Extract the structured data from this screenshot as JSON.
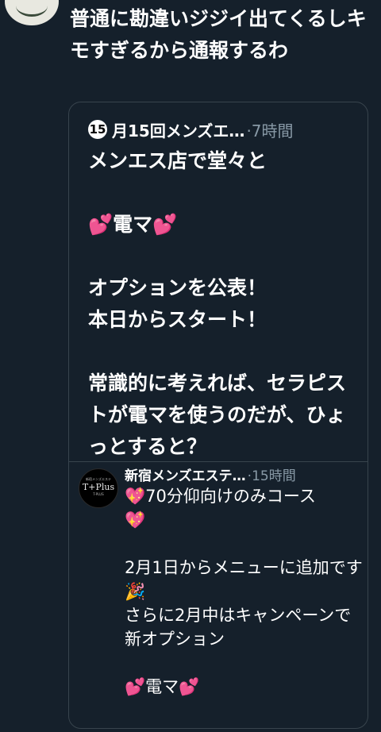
{
  "tweet": {
    "text": "普通に勘違いジジイ出てくるしキモすぎるから通報するわ"
  },
  "quote": {
    "badge": "15",
    "author_name": "月15回メンズエ…",
    "meta": "·7時間",
    "text": "メンエス店で堂々と\n\n💕電マ💕\n\nオプションを公表！\n本日からスタート！\n\n常識的に考えれば、セラピストが電マを使うのだが、ひょっとすると？"
  },
  "nested_quote": {
    "avatar_logo_top": "新宿メンズエステ",
    "avatar_logo": "T+Plus",
    "avatar_logo_bottom": "T-PLUS",
    "author_name": "新宿メンズエステ…",
    "meta": "·15時間",
    "text": "💖70分仰向けのみコース\n💖\n\n2月1日からメニューに追加です🎉\nさらに2月中はキャンペーンで新オプション\n\n💕電マ💕"
  },
  "colors": {
    "background": "#15202b",
    "border": "#38444d",
    "secondary_text": "#8899a6"
  }
}
